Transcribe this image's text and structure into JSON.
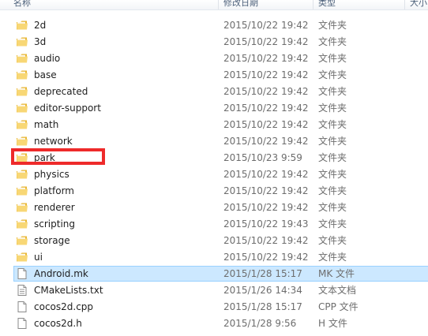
{
  "columns": {
    "name": "名称",
    "date": "修改日期",
    "type": "类型",
    "size": "大小"
  },
  "items": [
    {
      "name": "2d",
      "date": "2015/10/22 19:42",
      "type": "文件夹",
      "icon": "folder-icon"
    },
    {
      "name": "3d",
      "date": "2015/10/22 19:42",
      "type": "文件夹",
      "icon": "folder-icon"
    },
    {
      "name": "audio",
      "date": "2015/10/22 19:42",
      "type": "文件夹",
      "icon": "folder-icon"
    },
    {
      "name": "base",
      "date": "2015/10/22 19:42",
      "type": "文件夹",
      "icon": "folder-icon"
    },
    {
      "name": "deprecated",
      "date": "2015/10/22 19:42",
      "type": "文件夹",
      "icon": "folder-icon"
    },
    {
      "name": "editor-support",
      "date": "2015/10/22 19:42",
      "type": "文件夹",
      "icon": "folder-icon"
    },
    {
      "name": "math",
      "date": "2015/10/22 19:42",
      "type": "文件夹",
      "icon": "folder-icon"
    },
    {
      "name": "network",
      "date": "2015/10/22 19:42",
      "type": "文件夹",
      "icon": "folder-icon"
    },
    {
      "name": "park",
      "date": "2015/10/23 9:59",
      "type": "文件夹",
      "icon": "folder-icon"
    },
    {
      "name": "physics",
      "date": "2015/10/22 19:42",
      "type": "文件夹",
      "icon": "folder-icon"
    },
    {
      "name": "platform",
      "date": "2015/10/22 19:42",
      "type": "文件夹",
      "icon": "folder-icon"
    },
    {
      "name": "renderer",
      "date": "2015/10/22 19:42",
      "type": "文件夹",
      "icon": "folder-icon"
    },
    {
      "name": "scripting",
      "date": "2015/10/22 19:43",
      "type": "文件夹",
      "icon": "folder-icon"
    },
    {
      "name": "storage",
      "date": "2015/10/22 19:42",
      "type": "文件夹",
      "icon": "folder-icon"
    },
    {
      "name": "ui",
      "date": "2015/10/22 19:42",
      "type": "文件夹",
      "icon": "folder-icon"
    },
    {
      "name": "Android.mk",
      "date": "2015/1/28 15:17",
      "type": "MK 文件",
      "icon": "file-icon",
      "selected": true
    },
    {
      "name": "CMakeLists.txt",
      "date": "2015/1/26 14:34",
      "type": "文本文档",
      "icon": "text-file-icon"
    },
    {
      "name": "cocos2d.cpp",
      "date": "2015/1/28 15:17",
      "type": "CPP 文件",
      "icon": "file-icon"
    },
    {
      "name": "cocos2d.h",
      "date": "2015/1/28 9:56",
      "type": "H 文件",
      "icon": "file-icon"
    }
  ],
  "highlight": {
    "color": "#ee2a2a",
    "target": "park"
  },
  "colors": {
    "selection_bg": "#cce8ff",
    "selection_border": "#99d1ff",
    "folder": "#f5c94a",
    "secondary_text": "#6d6d6d"
  }
}
